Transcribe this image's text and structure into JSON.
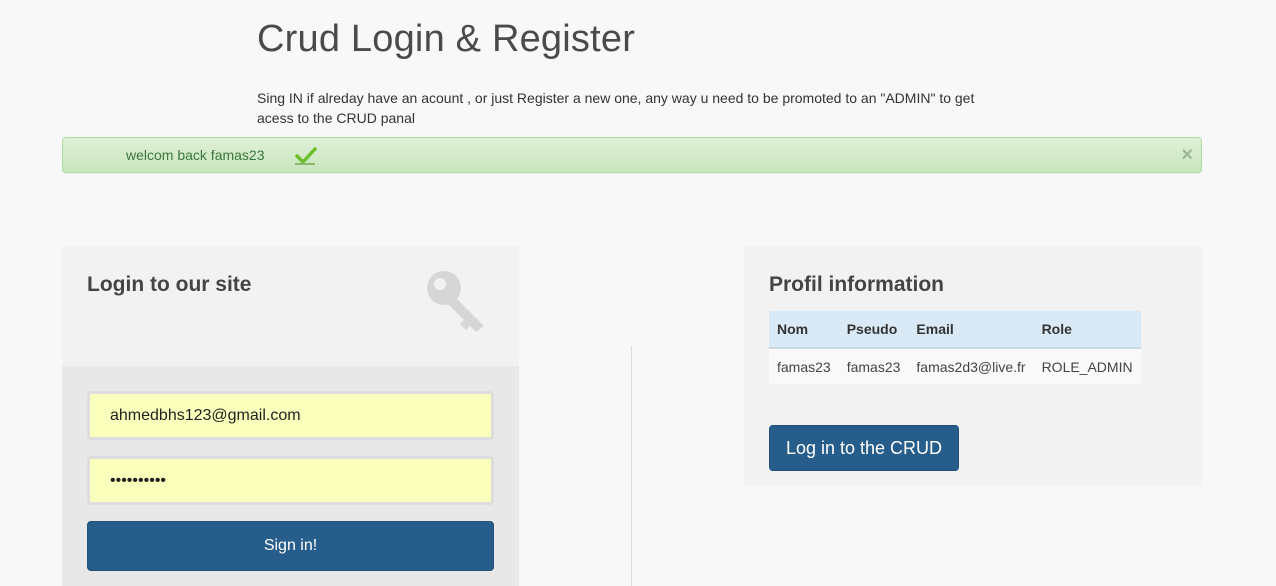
{
  "header": {
    "title": "Crud Login & Register",
    "description": "Sing IN if alreday have an acount , or just Register a new one, any way u need to be promoted to an \"ADMIN\" to get acess to the CRUD panal"
  },
  "alert": {
    "message": "welcom back famas23",
    "close_symbol": "×",
    "icon": "check-icon",
    "color": "#3c763d"
  },
  "login": {
    "title": "Login to our site",
    "icon": "key-icon",
    "email_value": "ahmedbhs123@gmail.com",
    "password_mask": "••••••••••",
    "signin_label": "Sign in!"
  },
  "profile": {
    "title": "Profil information",
    "columns": [
      "Nom",
      "Pseudo",
      "Email",
      "Role"
    ],
    "rows": [
      [
        "famas23",
        "famas23",
        "famas2d3@live.fr",
        "ROLE_ADMIN"
      ]
    ],
    "crud_button_label": "Log in to the CRUD"
  },
  "colors": {
    "primary": "#275d8b",
    "alert_bg": "#dff0d8",
    "input_bg": "#fbffbc"
  }
}
